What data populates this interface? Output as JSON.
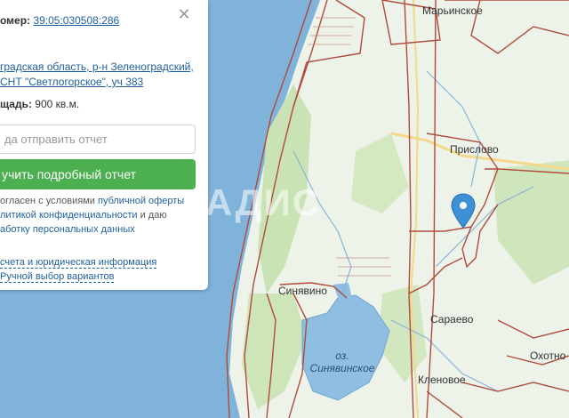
{
  "panel": {
    "cadastral_label": "омер:",
    "cadastral_number": "39:05:030508:286",
    "address_line1": "градская область, р-н Зеленоградский,",
    "address_line2": "СНТ \"Светлогорское\", уч 383",
    "area_label": "щадь:",
    "area_value": "900 кв.м.",
    "email_placeholder": "да отправить отчет",
    "report_button": "учить подробный отчет",
    "consent_1": "огласен с условиями ",
    "consent_link_1": "публичной оферты",
    "consent_2": "литикой конфиденциальности",
    "consent_3": " и даю",
    "consent_link_3": "аботку персональных данных",
    "link_1": "счета и юридическая информация",
    "link_2": "Ручной выбор вариантов",
    "close_icon": "close-icon"
  },
  "map": {
    "places": [
      "Марьинское",
      "Прислово",
      "Синявино",
      "Сараево",
      "Кленовое",
      "Охотно"
    ],
    "lake_prefix": "оз.",
    "lake_name": "Синявинское",
    "marker_icon": "location-pin-icon",
    "watermark": "ВЛАДИС",
    "colors": {
      "sea": "#7fb3d9",
      "land": "#eef3ea",
      "forest": "#c9e3b4",
      "parcel_border": "#b24a3c",
      "road": "#f3d98c",
      "marker": "#3d8fd6"
    }
  }
}
